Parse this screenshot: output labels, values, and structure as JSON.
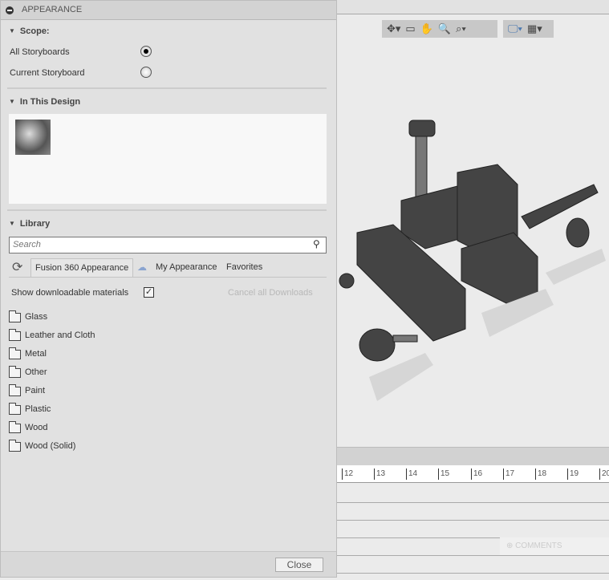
{
  "panel": {
    "title": "APPEARANCE",
    "scope": {
      "heading": "Scope:",
      "options": [
        {
          "label": "All Storyboards",
          "selected": true
        },
        {
          "label": "Current Storyboard",
          "selected": false
        }
      ]
    },
    "in_design": {
      "heading": "In This Design",
      "items": [
        {
          "icon": "metal-ring-thumbnail"
        }
      ]
    },
    "library": {
      "heading": "Library",
      "search_placeholder": "Search",
      "tabs": [
        "Fusion 360 Appearance",
        "My Appearance",
        "Favorites"
      ],
      "active_tab": 0,
      "show_downloadable": "Show downloadable materials",
      "show_downloadable_checked": true,
      "cancel_downloads": "Cancel all Downloads",
      "folders": [
        "Glass",
        "Leather and Cloth",
        "Metal",
        "Other",
        "Paint",
        "Plastic",
        "Wood",
        "Wood (Solid)"
      ]
    },
    "close": "Close"
  },
  "timeline": {
    "ruler": [
      "12",
      "13",
      "14",
      "15",
      "16",
      "17",
      "18",
      "19",
      "20"
    ],
    "comments": "COMMENTS"
  },
  "toolbar": {
    "icons": [
      "orbit-icon",
      "look-at-icon",
      "pan-icon",
      "zoom-icon",
      "fit-icon",
      "display-settings-icon",
      "grid-icon"
    ]
  }
}
